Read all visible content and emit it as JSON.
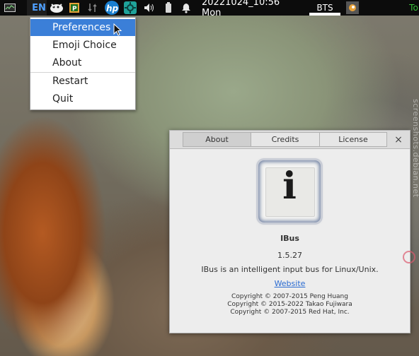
{
  "panel": {
    "language": "EN",
    "clock": "20221024_10:56 Mon",
    "workspace": "BTS",
    "corner_text": "To",
    "icons": [
      "system-monitor-icon",
      "mascot-icon",
      "clipboard-icon",
      "network-icon",
      "hp-icon",
      "settings-icon",
      "volume-icon",
      "battery-icon",
      "notification-bell-icon",
      "app-icon"
    ]
  },
  "menu": {
    "items": [
      {
        "label": "Preferences",
        "active": true
      },
      {
        "label": "Emoji Choice"
      },
      {
        "label": "About"
      },
      {
        "label": "Restart"
      },
      {
        "label": "Quit"
      }
    ]
  },
  "dialog": {
    "tabs": [
      "About",
      "Credits",
      "License"
    ],
    "active_tab": "About",
    "close": "×",
    "logo_glyph": "i",
    "app_name": "IBus",
    "version": "1.5.27",
    "description": "IBus is an intelligent input bus for Linux/Unix.",
    "website": "Website",
    "copyrights": [
      "Copyright © 2007-2015 Peng Huang",
      "Copyright © 2015-2022 Takao Fujiwara",
      "Copyright © 2007-2015 Red Hat, Inc."
    ]
  },
  "watermark": "screenshots.debian.net",
  "colors": {
    "accent": "#3b7fd8",
    "link": "#2a6bd1",
    "panel": "#0c0c0c"
  }
}
